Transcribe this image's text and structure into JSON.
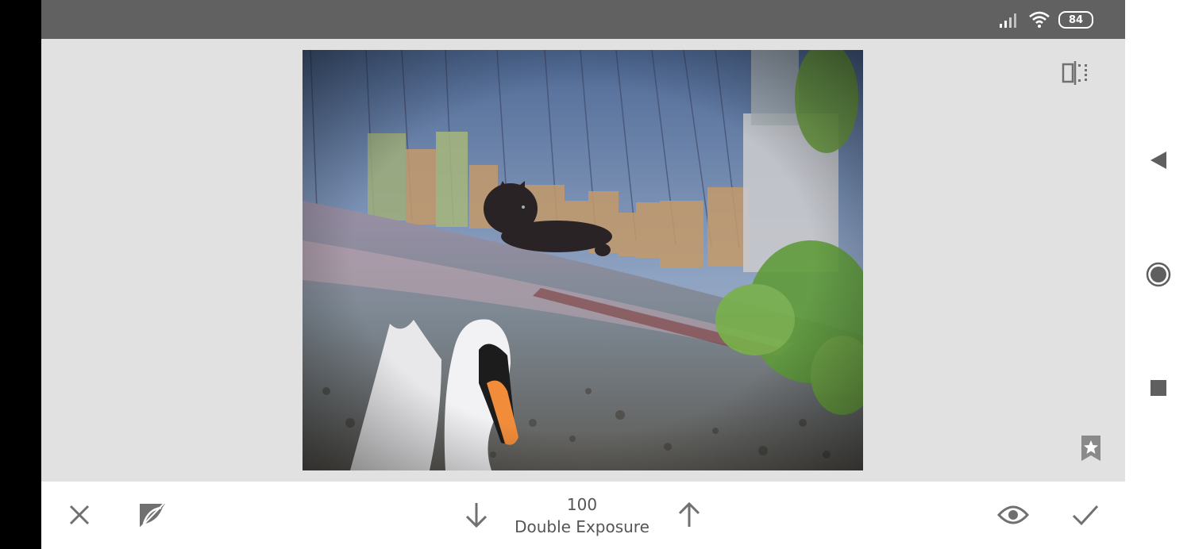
{
  "status_bar": {
    "battery_level": "84",
    "icons": [
      "signal-icon",
      "wifi-icon",
      "battery-icon"
    ]
  },
  "editor": {
    "compare_icon": "compare-split-icon",
    "bookmark_icon": "bookmark-star-icon",
    "photo_description": "double exposure of a cat on a wooden fence and a white swan in water"
  },
  "toolbar": {
    "cancel_icon": "close-icon",
    "erase_icon": "brush-erase-icon",
    "decrease_icon": "arrow-down-icon",
    "increase_icon": "arrow-up-icon",
    "value": "100",
    "effect_label": "Double Exposure",
    "preview_icon": "eye-icon",
    "apply_icon": "check-icon"
  },
  "nav_bar": {
    "back_icon": "back-triangle-icon",
    "home_icon": "home-circle-icon",
    "recents_icon": "recents-square-icon"
  },
  "colors": {
    "status_bar": "#616161",
    "canvas_bg": "#e1e1e1",
    "icon_gray": "#707070"
  }
}
